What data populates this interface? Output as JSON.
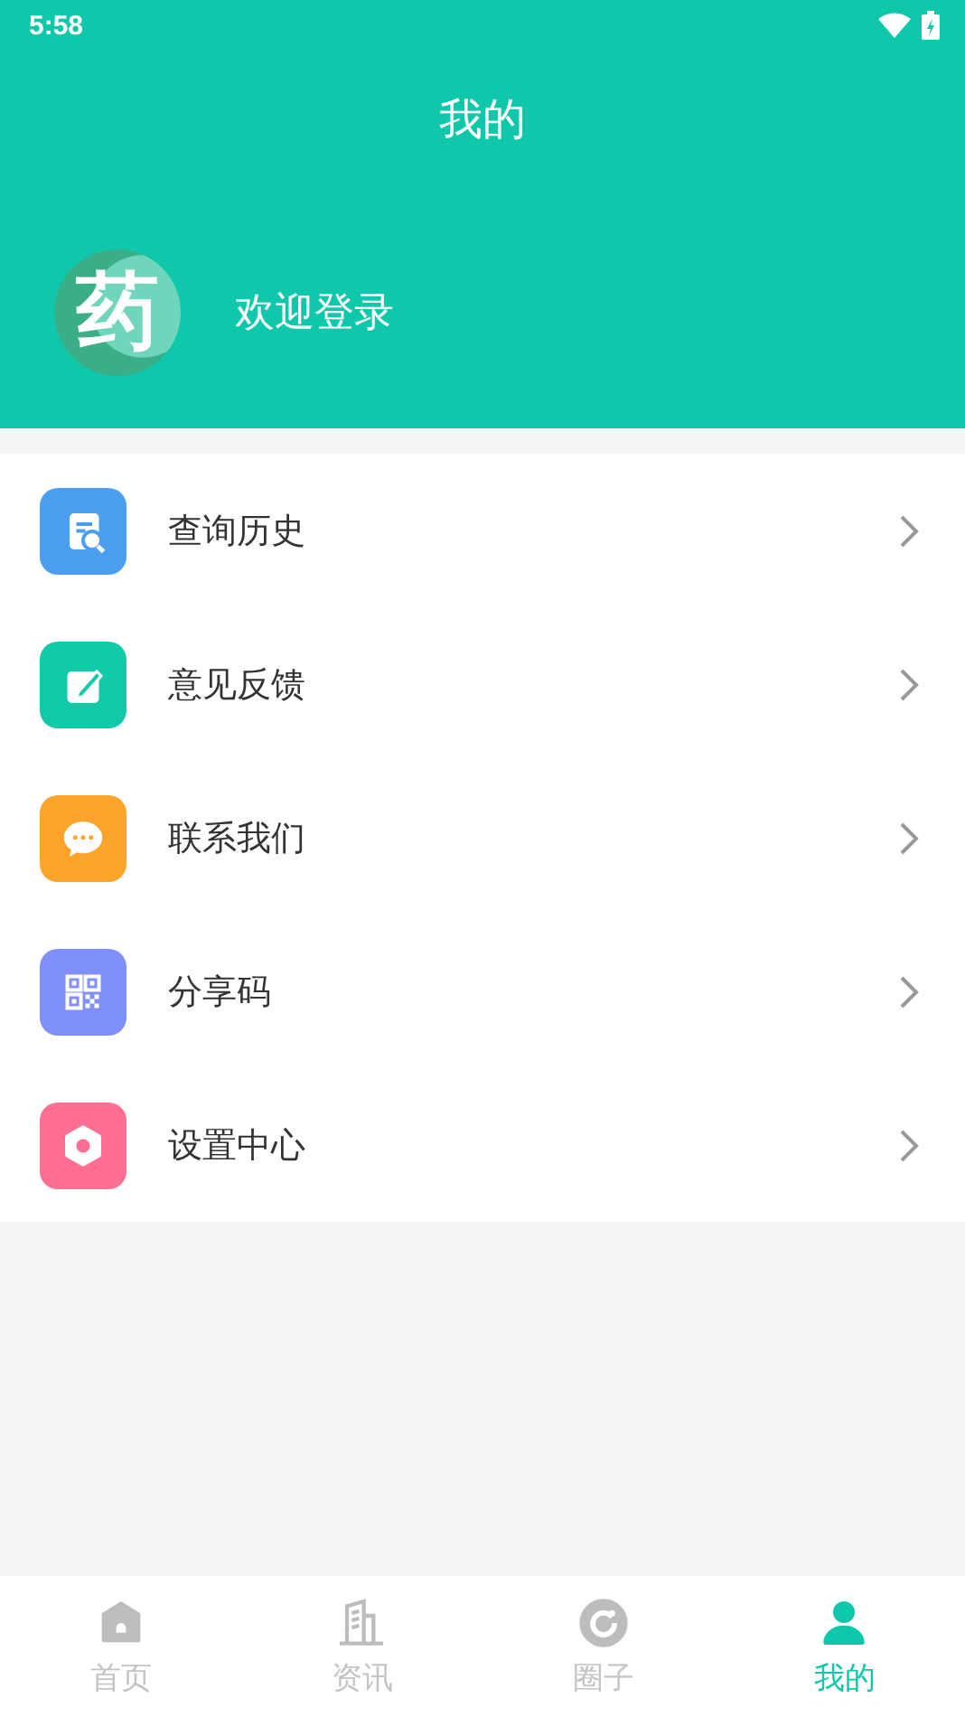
{
  "status_bar": {
    "time": "5:58"
  },
  "header": {
    "title": "我的"
  },
  "profile": {
    "avatar_text": "药",
    "login_text": "欢迎登录"
  },
  "menu": [
    {
      "label": "查询历史",
      "kind": "history",
      "color": "#4a9ff0"
    },
    {
      "label": "意见反馈",
      "kind": "feedback",
      "color": "#12c9a8"
    },
    {
      "label": "联系我们",
      "kind": "chat",
      "color": "#ffa42a"
    },
    {
      "label": "分享码",
      "kind": "qr",
      "color": "#8090fb"
    },
    {
      "label": "设置中心",
      "kind": "settings",
      "color": "#ff6f92"
    }
  ],
  "tabs": [
    {
      "label": "首页",
      "kind": "home",
      "selected": false
    },
    {
      "label": "资讯",
      "kind": "news",
      "selected": false
    },
    {
      "label": "圈子",
      "kind": "circle",
      "selected": false
    },
    {
      "label": "我的",
      "kind": "me",
      "selected": true
    }
  ]
}
